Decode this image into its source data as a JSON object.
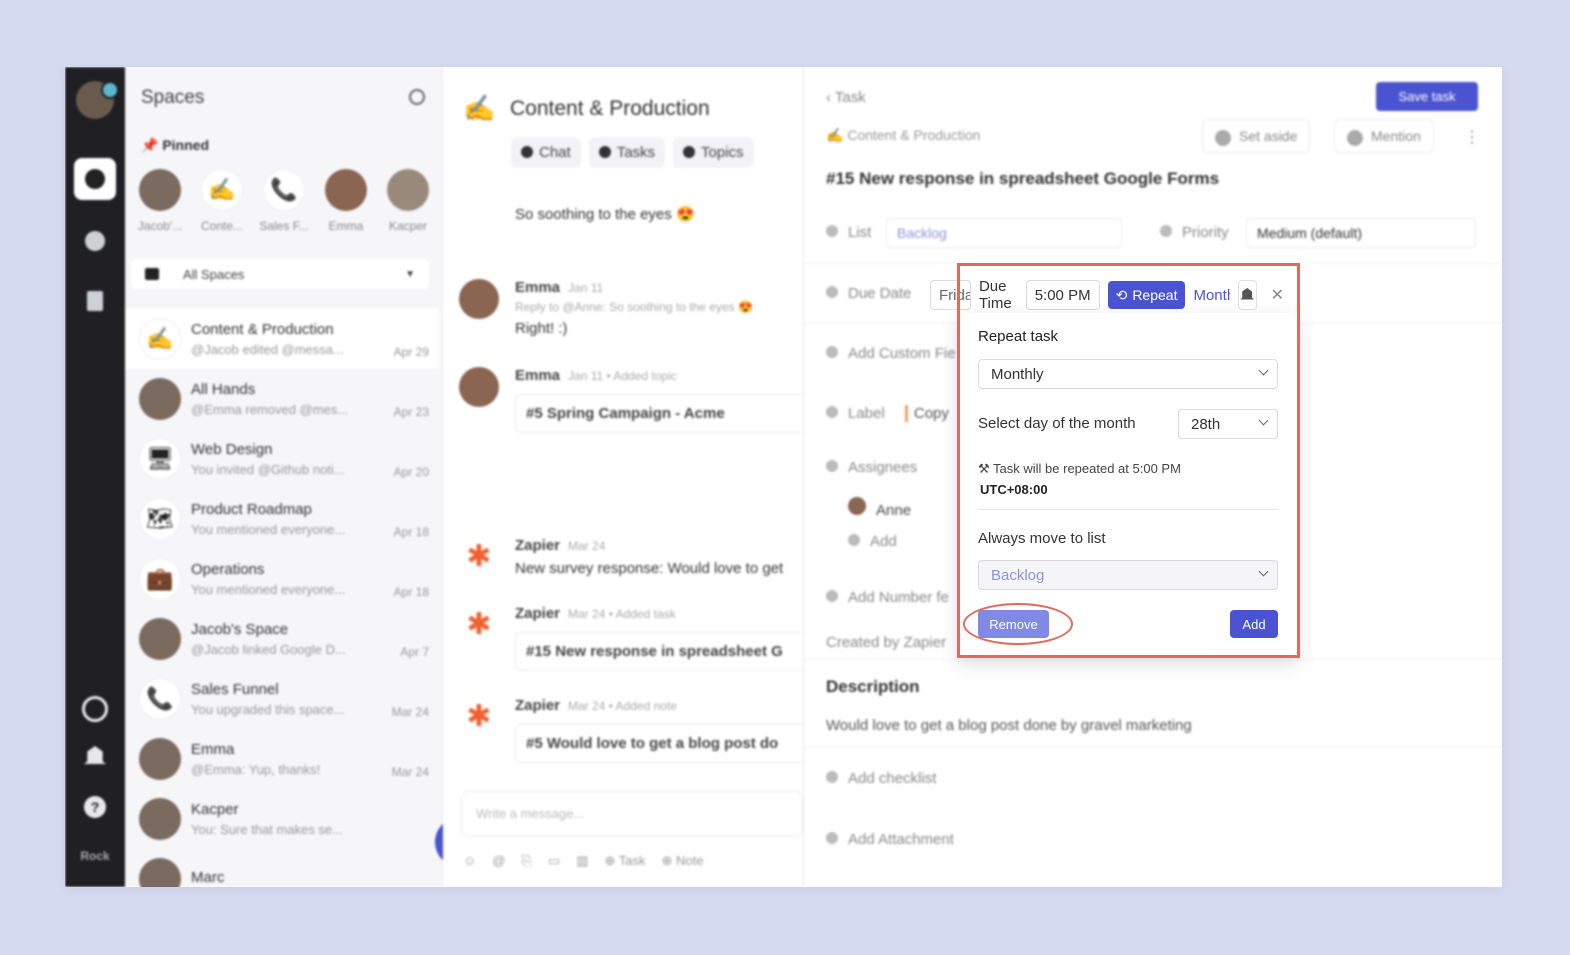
{
  "sidebar": {
    "title": "Spaces",
    "pinned_label": "Pinned",
    "pinned": [
      {
        "label": "Jacob'..."
      },
      {
        "label": "Conte..."
      },
      {
        "label": "Sales F..."
      },
      {
        "label": "Emma"
      },
      {
        "label": "Kacper"
      }
    ],
    "filter": "All Spaces",
    "rooms": [
      {
        "title": "Content & Production",
        "subtitle": "@Jacob edited @messa...",
        "date": "Apr 29",
        "emoji": "✍"
      },
      {
        "title": "All Hands",
        "subtitle": "@Emma removed @mes...",
        "date": "Apr 23",
        "emoji": ""
      },
      {
        "title": "Web Design",
        "subtitle": "You invited @Github noti...",
        "date": "Apr 20",
        "emoji": "🖥"
      },
      {
        "title": "Product Roadmap",
        "subtitle": "You mentioned everyone...",
        "date": "Apr 18",
        "emoji": "🗺"
      },
      {
        "title": "Operations",
        "subtitle": "You mentioned everyone...",
        "date": "Apr 18",
        "emoji": "💼"
      },
      {
        "title": "Jacob's Space",
        "subtitle": "@Jacob linked Google D...",
        "date": "Apr 7",
        "emoji": ""
      },
      {
        "title": "Sales Funnel",
        "subtitle": "You upgraded this space...",
        "date": "Mar 24",
        "emoji": "📞"
      },
      {
        "title": "Emma",
        "subtitle": "@Emma: Yup, thanks!",
        "date": "Mar 24",
        "emoji": ""
      },
      {
        "title": "Kacper",
        "subtitle": "You: Sure that makes se...",
        "date": "",
        "emoji": ""
      },
      {
        "title": "Marc",
        "subtitle": "",
        "date": "",
        "emoji": ""
      }
    ],
    "rail_wordmark": "Rock"
  },
  "chat": {
    "title": "Content & Production",
    "tabs": [
      "Chat",
      "Tasks",
      "Topics"
    ],
    "messages": [
      {
        "text": "So soothing to the eyes 😍"
      },
      {
        "name": "Emma",
        "date": "Jan 11",
        "reply": "Reply to @Anne: So soothing to the eyes 😍",
        "text": "Right! :)"
      },
      {
        "name": "Emma",
        "date": "Jan 11 • Added topic",
        "card": "#5 Spring Campaign - Acme"
      },
      {
        "name": "Zapier",
        "date": "Mar 24",
        "text": "New survey response: Would love to get"
      },
      {
        "name": "Zapier",
        "date": "Mar 24 • Added task",
        "card": "#15 New response in spreadsheet G"
      },
      {
        "name": "Zapier",
        "date": "Mar 24 • Added note",
        "card": "#5 Would love to get a blog post do"
      }
    ],
    "composer_placeholder": "Write a message...",
    "tool_task": "Task",
    "tool_note": "Note"
  },
  "task": {
    "back": "Task",
    "save": "Save task",
    "project": "Content & Production",
    "set_aside": "Set aside",
    "mention": "Mention",
    "title": "#15  New response in spreadsheet Google Forms",
    "list_label": "List",
    "list_value": "Backlog",
    "priority_label": "Priority",
    "priority_value": "Medium (default)",
    "due_date_label": "Due Date",
    "due_date_value": "Friday",
    "due_time_label": "Due Time",
    "due_time_value": "5:00 PM",
    "repeat_label": "Repeat",
    "repeat_value": "Monthly",
    "custom_field": "Add Custom Fie",
    "label": "Label",
    "label_value": "Copy",
    "assignees": "Assignees",
    "assignee": "Anne",
    "add": "Add",
    "number_field": "Add Number fe",
    "created_by": "Created by Zapier",
    "description_title": "Description",
    "description": "Would love to get a blog post done by gravel marketing",
    "checklist": "Add checklist",
    "attachment": "Add Attachment"
  },
  "popup": {
    "title": "Repeat task",
    "frequency": "Monthly",
    "day_label": "Select day of the month",
    "day_value": "28th",
    "note": "Task will be repeated at 5:00 PM",
    "timezone": "UTC+08:00",
    "move_label": "Always move to list",
    "move_value": "Backlog",
    "remove": "Remove",
    "add": "Add"
  },
  "colors": {
    "accent": "#4a54d1",
    "highlight": "#e06a5b",
    "background": "#d6daf0"
  }
}
